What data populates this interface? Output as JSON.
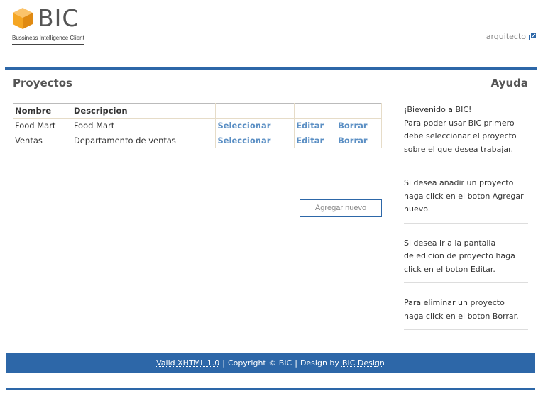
{
  "header": {
    "logo_text": "BIC",
    "logo_subtitle": "Bussiness Intelligence Client",
    "user_link": "arquitecto"
  },
  "sections": {
    "projects_title": "Proyectos",
    "help_title": "Ayuda"
  },
  "table": {
    "headers": [
      "Nombre",
      "Descripcion",
      "",
      "",
      ""
    ],
    "rows": [
      {
        "name": "Food Mart",
        "description": "Food Mart",
        "select": "Seleccionar",
        "edit": "Editar",
        "delete": "Borrar"
      },
      {
        "name": "Ventas",
        "description": "Departamento de ventas",
        "select": "Seleccionar",
        "edit": "Editar",
        "delete": "Borrar"
      }
    ]
  },
  "add_button": "Agregar nuevo",
  "help": {
    "block1": [
      "¡Bievenido a BIC!",
      "Para poder usar BIC primero",
      "debe seleccionar el proyecto",
      "sobre el que desea trabajar."
    ],
    "block2": [
      "Si desea añadir un proyecto",
      "haga click en el boton Agregar",
      "nuevo."
    ],
    "block3": [
      "Si desea ir a la pantalla",
      "de edicion de proyecto haga",
      "click en el boton Editar."
    ],
    "block4": [
      "Para eliminar un proyecto",
      "haga click en el boton Borrar."
    ]
  },
  "footer": {
    "xhtml_link": "Valid XHTML 1.0",
    "sep1": "|",
    "copyright": "Copyright © BIC",
    "sep2": "|",
    "design_by": "Design by",
    "design_link": "BIC Design"
  },
  "colors": {
    "accent": "#2d67a8",
    "link": "#5b8fc4",
    "logo_orange": "#f5a623"
  }
}
